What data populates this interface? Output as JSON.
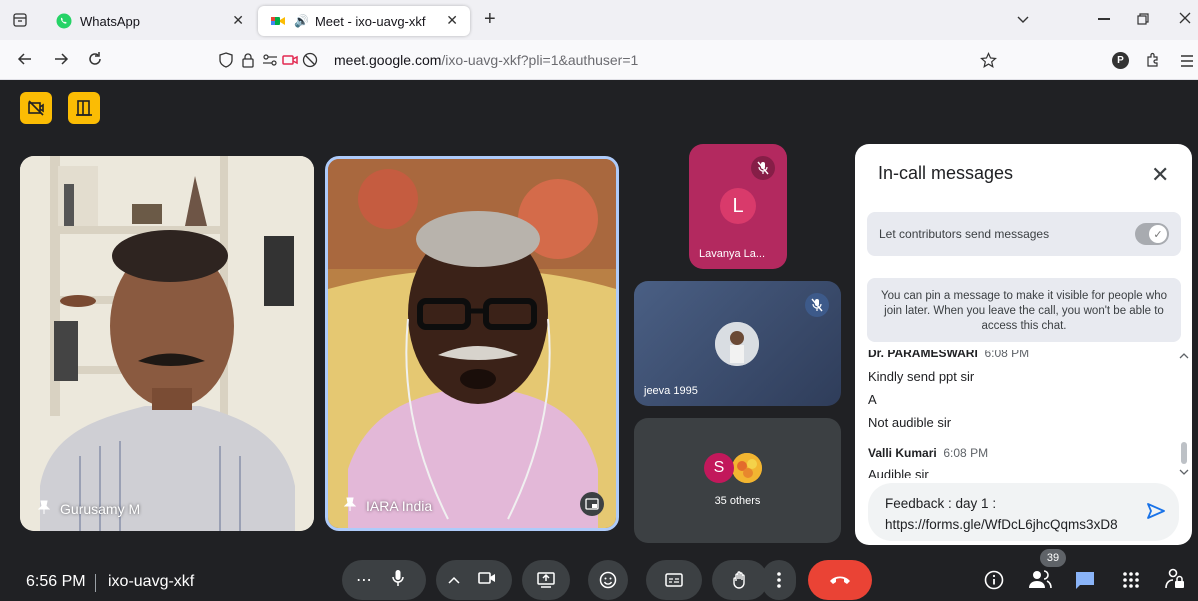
{
  "browser": {
    "tabs": [
      {
        "title": "WhatsApp",
        "active": false
      },
      {
        "title": "Meet - ixo-uavg-xkf",
        "active": true
      }
    ],
    "url_domain": "meet.google.com",
    "url_path": "/ixo-uavg-xkf?pli=1&authuser=1",
    "profile_initial": "P",
    "new_tab_label": "+",
    "close_glyph": "✕"
  },
  "participants": [
    {
      "name": "Gurusamy M",
      "pinned": true
    },
    {
      "name": "IARA India",
      "pinned": true
    },
    {
      "name": "Lavanya La...",
      "initial": "L",
      "muted": true
    },
    {
      "name": "jeeva 1995",
      "muted": true
    },
    {
      "name": "35 others",
      "initial": "S"
    }
  ],
  "chat": {
    "title": "In-call messages",
    "close_glyph": "✕",
    "allow_label": "Let contributors send messages",
    "allow_enabled": true,
    "pin_notice": "You can pin a message to make it visible for people who join later. When you leave the call, you won't be able to access this chat.",
    "messages": [
      {
        "sender": "Dr. PARAMESWARI",
        "time": "6:08 PM",
        "lines": [
          "Kindly send ppt sir",
          "A",
          "Not audible sir"
        ]
      },
      {
        "sender": "Valli Kumari",
        "time": "6:08 PM",
        "lines": [
          "Audible sir"
        ]
      }
    ],
    "compose_text": "Feedback : day 1 : https://forms.gle/WfDcL6jhcQqms3xD8"
  },
  "bottom_bar": {
    "time": "6:56 PM",
    "meeting_code": "ixo-uavg-xkf",
    "participant_count": "39"
  },
  "colors": {
    "meet_bg": "#202124",
    "end_call": "#ea4335",
    "accent_yellow": "#fbbc04",
    "chat_active": "#8ab4f8",
    "lavanya_tile": "#b3295f",
    "avatar_l": "#d93a6b",
    "avatar_s": "#c2185b"
  }
}
